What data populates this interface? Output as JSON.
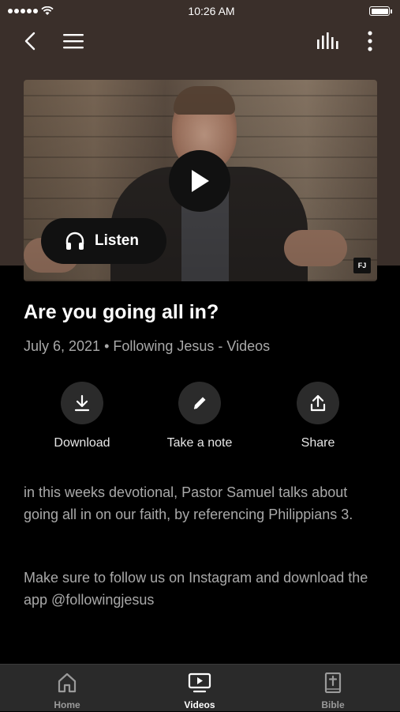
{
  "status_bar": {
    "time": "10:26 AM"
  },
  "video": {
    "listen_label": "Listen",
    "badge": "FJ"
  },
  "content": {
    "title": "Are you going all in?",
    "meta": "July 6, 2021 • Following Jesus - Videos",
    "actions": [
      {
        "label": "Download",
        "icon": "download-icon"
      },
      {
        "label": "Take a note",
        "icon": "pencil-icon"
      },
      {
        "label": "Share",
        "icon": "share-icon"
      }
    ],
    "description": [
      "in this weeks devotional, Pastor Samuel talks about going all in on our faith, by referencing Philippians 3.",
      "Make sure to follow us on Instagram and download the app @followingjesus"
    ]
  },
  "tabs": [
    {
      "label": "Home",
      "icon": "home-icon",
      "active": false
    },
    {
      "label": "Videos",
      "icon": "video-icon",
      "active": true
    },
    {
      "label": "Bible",
      "icon": "bible-icon",
      "active": false
    }
  ],
  "colors": {
    "header_bg": "#3a2f2a",
    "background": "#000000",
    "tabbar_bg": "#2a2a2a"
  }
}
